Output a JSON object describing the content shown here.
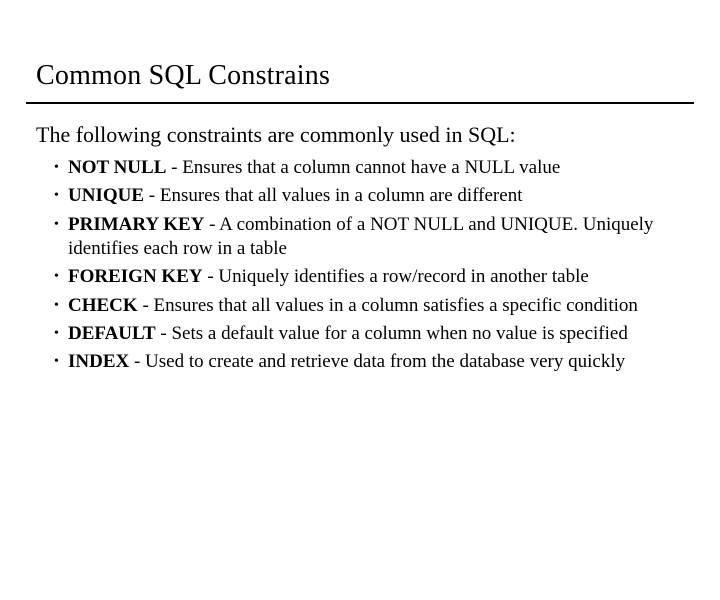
{
  "title": "Common SQL Constrains",
  "intro": "The following constraints are commonly used in SQL:",
  "items": [
    {
      "kw": "NOT NULL",
      "desc": " - Ensures that a column cannot have a NULL value"
    },
    {
      "kw": "UNIQUE",
      "desc": " - Ensures that all values in a column are different"
    },
    {
      "kw": "PRIMARY KEY",
      "desc": " - A combination of a NOT NULL and UNIQUE. Uniquely identifies each row in a table"
    },
    {
      "kw": "FOREIGN KEY",
      "desc": " - Uniquely identifies a row/record in another table"
    },
    {
      "kw": "CHECK",
      "desc": " - Ensures that all values in a column satisfies a specific condition"
    },
    {
      "kw": "DEFAULT",
      "desc": " - Sets a default value for a column when no value is specified"
    },
    {
      "kw": "INDEX",
      "desc": " - Used to create and retrieve data from the database very quickly"
    }
  ]
}
